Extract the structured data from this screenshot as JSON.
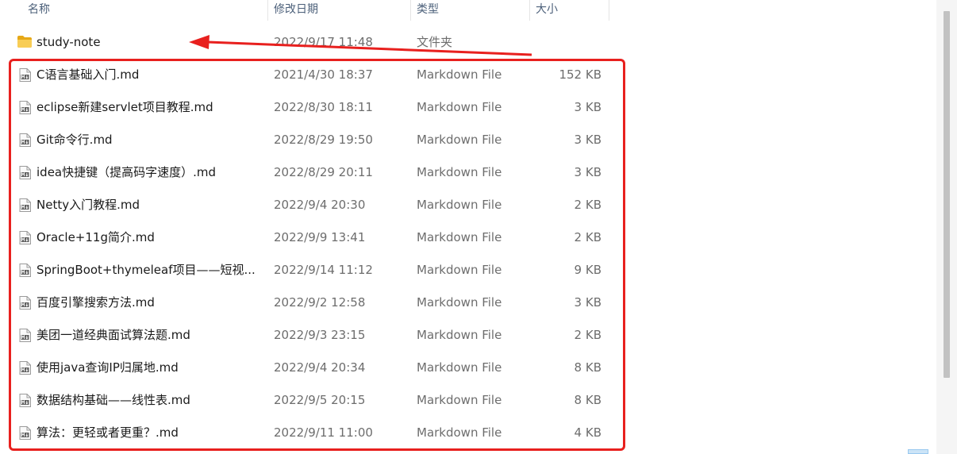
{
  "columns": {
    "name": "名称",
    "date": "修改日期",
    "type": "类型",
    "size": "大小"
  },
  "folder": {
    "name": "study-note",
    "date": "2022/9/17 11:48",
    "type": "文件夹",
    "size": "",
    "icon": "folder-icon"
  },
  "files": [
    {
      "name": "C语言基础入门.md",
      "date": "2021/4/30 18:37",
      "type": "Markdown File",
      "size": "152 KB",
      "icon": "markdown-file-icon"
    },
    {
      "name": "eclipse新建servlet项目教程.md",
      "date": "2022/8/30 18:11",
      "type": "Markdown File",
      "size": "3 KB",
      "icon": "markdown-file-icon"
    },
    {
      "name": "Git命令行.md",
      "date": "2022/8/29 19:50",
      "type": "Markdown File",
      "size": "3 KB",
      "icon": "markdown-file-icon"
    },
    {
      "name": "idea快捷键（提高码字速度）.md",
      "date": "2022/8/29 20:11",
      "type": "Markdown File",
      "size": "3 KB",
      "icon": "markdown-file-icon"
    },
    {
      "name": "Netty入门教程.md",
      "date": "2022/9/4 20:30",
      "type": "Markdown File",
      "size": "2 KB",
      "icon": "markdown-file-icon"
    },
    {
      "name": "Oracle+11g简介.md",
      "date": "2022/9/9 13:41",
      "type": "Markdown File",
      "size": "2 KB",
      "icon": "markdown-file-icon"
    },
    {
      "name": "SpringBoot+thymeleaf项目——短视...",
      "date": "2022/9/14 11:12",
      "type": "Markdown File",
      "size": "9 KB",
      "icon": "markdown-file-icon"
    },
    {
      "name": "百度引擎搜索方法.md",
      "date": "2022/9/2 12:58",
      "type": "Markdown File",
      "size": "3 KB",
      "icon": "markdown-file-icon"
    },
    {
      "name": "美团一道经典面试算法题.md",
      "date": "2022/9/3 23:15",
      "type": "Markdown File",
      "size": "2 KB",
      "icon": "markdown-file-icon"
    },
    {
      "name": "使用java查询IP归属地.md",
      "date": "2022/9/4 20:34",
      "type": "Markdown File",
      "size": "8 KB",
      "icon": "markdown-file-icon"
    },
    {
      "name": "数据结构基础——线性表.md",
      "date": "2022/9/5 20:15",
      "type": "Markdown File",
      "size": "8 KB",
      "icon": "markdown-file-icon"
    },
    {
      "name": "算法：更轻或者更重？.md",
      "date": "2022/9/11 11:00",
      "type": "Markdown File",
      "size": "4 KB",
      "icon": "markdown-file-icon"
    }
  ],
  "colors": {
    "annotation": "#e8201e",
    "folder": "#f5c33b",
    "header_text": "#4c607a"
  }
}
